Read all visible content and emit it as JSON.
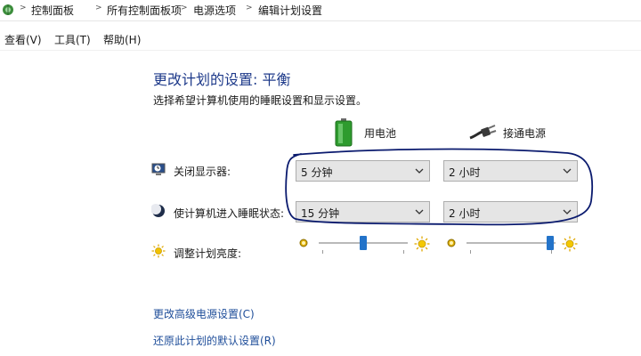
{
  "breadcrumb": {
    "items": [
      "控制面板",
      "所有控制面板项",
      "电源选项",
      "编辑计划设置"
    ]
  },
  "menu": {
    "view": "查看(V)",
    "tools": "工具(T)",
    "help": "帮助(H)"
  },
  "main": {
    "title": "更改计划的设置: 平衡",
    "subtitle": "选择希望计算机使用的睡眠设置和显示设置。",
    "columns": {
      "battery": "用电池",
      "plugged": "接通电源"
    },
    "rows": {
      "display_off": {
        "label": "关闭显示器:",
        "battery_value": "5 分钟",
        "plugged_value": "2 小时"
      },
      "sleep": {
        "label": "使计算机进入睡眠状态:",
        "battery_value": "15 分钟",
        "plugged_value": "2 小时"
      },
      "brightness": {
        "label": "调整计划亮度:",
        "battery_level": 0.5,
        "plugged_level": 0.98
      }
    },
    "links": {
      "advanced": "更改高级电源设置(C)",
      "restore": "还原此计划的默认设置(R)"
    }
  },
  "colors": {
    "title": "#1e3a8a",
    "link": "#1f4e9a",
    "slider_thumb": "#2373c9",
    "annotation": "#0a1a6e"
  },
  "icons": {
    "control_panel": "control-panel-icon",
    "battery": "battery-icon",
    "plug": "power-plug-icon",
    "display": "display-clock-icon",
    "sleep": "moon-icon",
    "brightness": "sun-icon"
  }
}
